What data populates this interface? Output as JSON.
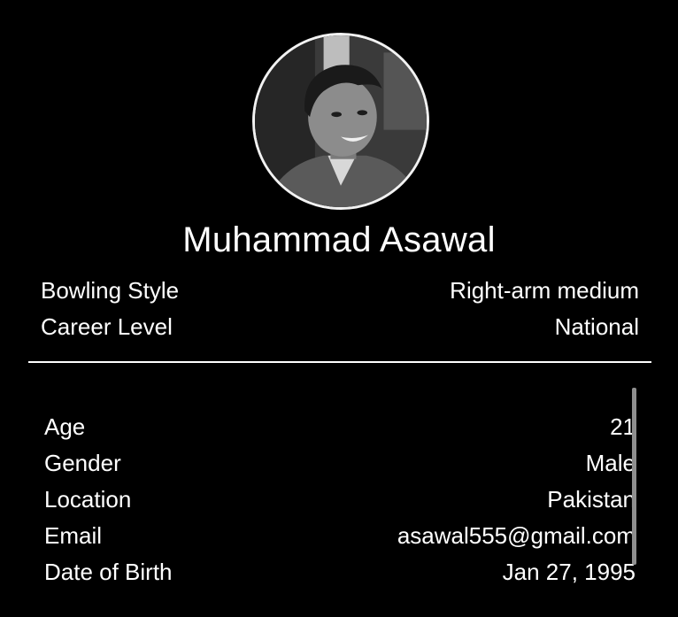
{
  "profile": {
    "name": "Muhammad Asawal",
    "avatar_icon": "profile-photo"
  },
  "summary": [
    {
      "label": "Bowling Style",
      "value": "Right-arm medium"
    },
    {
      "label": "Career Level",
      "value": "National"
    }
  ],
  "details": [
    {
      "label": "Age",
      "value": "21"
    },
    {
      "label": "Gender",
      "value": "Male"
    },
    {
      "label": "Location",
      "value": "Pakistan"
    },
    {
      "label": "Email",
      "value": "asawal555@gmail.com"
    },
    {
      "label": "Date of Birth",
      "value": "Jan 27, 1995"
    }
  ],
  "colors": {
    "background": "#000000",
    "text": "#ffffff",
    "divider": "#ffffff",
    "scrollbar": "#8f8f8f"
  }
}
